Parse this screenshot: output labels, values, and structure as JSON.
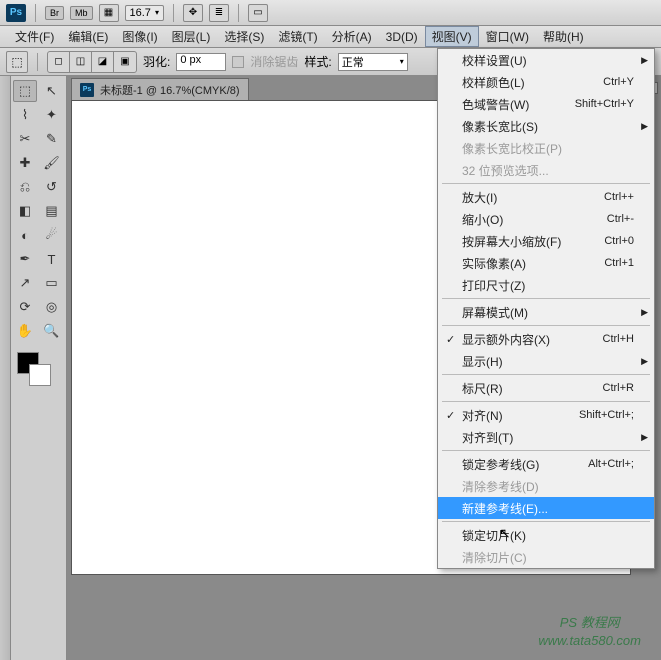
{
  "topbar": {
    "ps": "Ps",
    "chip1": "Br",
    "chip2": "Mb",
    "zoom": "16.7"
  },
  "menu": {
    "items": [
      "文件(F)",
      "编辑(E)",
      "图像(I)",
      "图层(L)",
      "选择(S)",
      "滤镜(T)",
      "分析(A)",
      "3D(D)",
      "视图(V)",
      "窗口(W)",
      "帮助(H)"
    ]
  },
  "options": {
    "feather_label": "羽化:",
    "feather_value": "0 px",
    "antialias": "消除锯齿",
    "style_label": "样式:",
    "style_value": "正常"
  },
  "doc": {
    "title": "未标题-1 @ 16.7%(CMYK/8)"
  },
  "dropdown": {
    "rows": [
      {
        "t": "校样设置(U)",
        "arr": true
      },
      {
        "t": "校样颜色(L)",
        "sc": "Ctrl+Y"
      },
      {
        "t": "色域警告(W)",
        "sc": "Shift+Ctrl+Y"
      },
      {
        "t": "像素长宽比(S)",
        "arr": true
      },
      {
        "t": "像素长宽比校正(P)",
        "dis": true
      },
      {
        "t": "32 位预览选项...",
        "dis": true
      },
      {
        "sep": true
      },
      {
        "t": "放大(I)",
        "sc": "Ctrl++"
      },
      {
        "t": "缩小(O)",
        "sc": "Ctrl+-"
      },
      {
        "t": "按屏幕大小缩放(F)",
        "sc": "Ctrl+0"
      },
      {
        "t": "实际像素(A)",
        "sc": "Ctrl+1"
      },
      {
        "t": "打印尺寸(Z)"
      },
      {
        "sep": true
      },
      {
        "t": "屏幕模式(M)",
        "arr": true
      },
      {
        "sep": true
      },
      {
        "t": "显示额外内容(X)",
        "sc": "Ctrl+H",
        "chk": true
      },
      {
        "t": "显示(H)",
        "arr": true
      },
      {
        "sep": true
      },
      {
        "t": "标尺(R)",
        "sc": "Ctrl+R"
      },
      {
        "sep": true
      },
      {
        "t": "对齐(N)",
        "sc": "Shift+Ctrl+;",
        "chk": true
      },
      {
        "t": "对齐到(T)",
        "arr": true
      },
      {
        "sep": true
      },
      {
        "t": "锁定参考线(G)",
        "sc": "Alt+Ctrl+;"
      },
      {
        "t": "清除参考线(D)",
        "dis": true
      },
      {
        "t": "新建参考线(E)...",
        "hl": true
      },
      {
        "sep": true
      },
      {
        "t": "锁定切片(K)"
      },
      {
        "t": "清除切片(C)",
        "dis": true
      }
    ]
  },
  "watermark": {
    "l1": "PS 教程网",
    "l2": "www.tata580.com"
  }
}
